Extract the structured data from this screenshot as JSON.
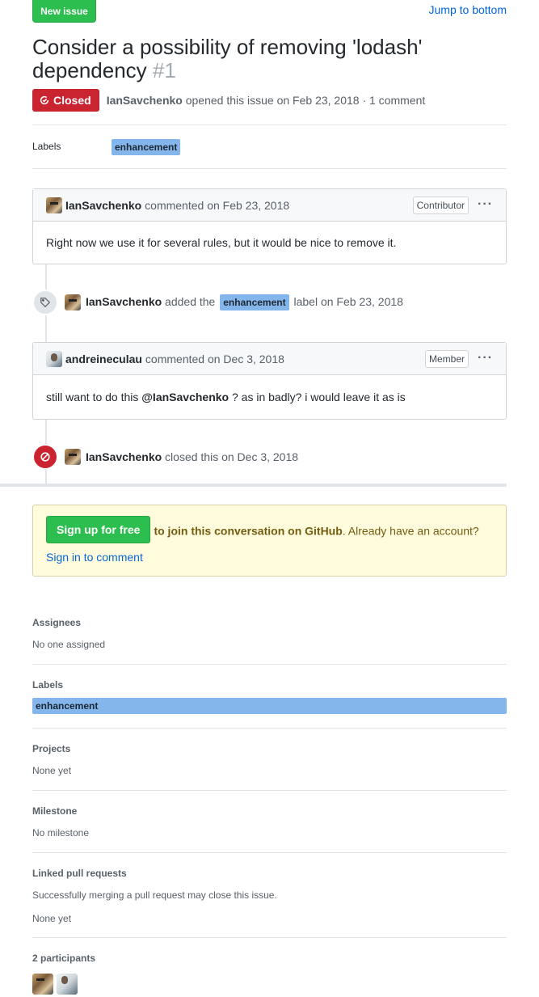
{
  "header": {
    "new_issue_label": "New issue",
    "jump_label": "Jump to bottom"
  },
  "issue": {
    "title": "Consider a possibility of removing 'lodash' dependency",
    "number": "#1",
    "state": "Closed",
    "author": "IanSavchenko",
    "opened_text": "opened this issue on Feb 23, 2018 · 1 comment",
    "labels_title": "Labels",
    "label": "enhancement"
  },
  "timeline": {
    "comment1": {
      "author": "IanSavchenko",
      "when": "commented on Feb 23, 2018",
      "role": "Contributor",
      "menu": "···",
      "body": "Right now we use it for several rules, but it would be nice to remove it."
    },
    "label_event": {
      "author": "IanSavchenko",
      "pre": "added the",
      "label": "enhancement",
      "post": "label on Feb 23, 2018"
    },
    "comment2": {
      "author": "andreineculau",
      "when": "commented on Dec 3, 2018",
      "role": "Member",
      "menu": "···",
      "body_pre": "still want to do this",
      "mention": "@IanSavchenko",
      "body_post": "? as in badly? i would leave it as is"
    },
    "close_event": {
      "author": "IanSavchenko",
      "text": "closed this on Dec 3, 2018"
    }
  },
  "signup": {
    "button": "Sign up for free",
    "strong_text": "to join this conversation on GitHub",
    "middle_text": ". Already have an account?",
    "link": "Sign in to comment"
  },
  "sidebar": {
    "assignees": {
      "title": "Assignees",
      "value": "No one assigned"
    },
    "labels": {
      "title": "Labels",
      "value": "enhancement"
    },
    "projects": {
      "title": "Projects",
      "value": "None yet"
    },
    "milestone": {
      "title": "Milestone",
      "value": "No milestone"
    },
    "linked_prs": {
      "title": "Linked pull requests",
      "hint": "Successfully merging a pull request may close this issue.",
      "value": "None yet"
    },
    "participants": {
      "title": "2 participants"
    }
  },
  "colors": {
    "closed_red": "#cb2431",
    "green": "#2cbe4e",
    "label_blue": "#84b6eb",
    "link_blue": "#0366d6"
  }
}
